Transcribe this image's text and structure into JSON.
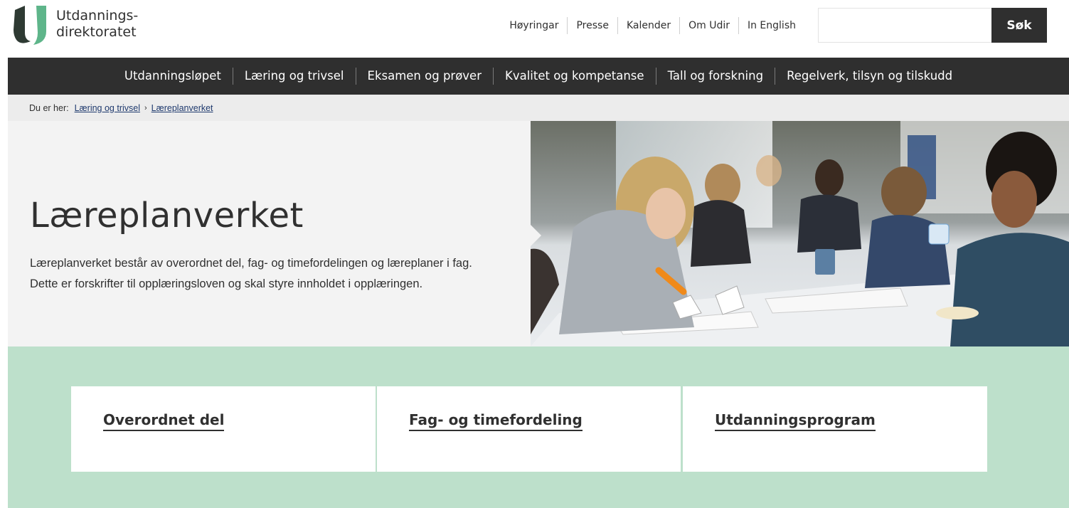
{
  "header": {
    "logo_line1": "Utdannings-",
    "logo_line2": "direktoratet",
    "utility_links": [
      "Høyringar",
      "Presse",
      "Kalender",
      "Om Udir",
      "In English"
    ],
    "search": {
      "placeholder": "",
      "value": "",
      "button_label": "Søk"
    }
  },
  "main_nav": [
    "Utdanningsløpet",
    "Læring og trivsel",
    "Eksamen og prøver",
    "Kvalitet og kompetanse",
    "Tall og forskning",
    "Regelverk, tilsyn og tilskudd"
  ],
  "breadcrumb": {
    "label": "Du er her:",
    "items": [
      "Læring og trivsel",
      "Læreplanverket"
    ],
    "separator": "›"
  },
  "hero": {
    "title": "Læreplanverket",
    "description": "Læreplanverket består av overordnet del, fag- og timefordelingen og læreplaner i fag. Dette er forskrifter til opplæringsloven og skal styre innholdet i opplæringen."
  },
  "cards": [
    "Overordnet del",
    "Fag- og timefordeling",
    "Utdanningsprogram"
  ],
  "colors": {
    "dark": "#2f2f2f",
    "green_bg": "#bde0cb",
    "logo_dark": "#2e3a33",
    "logo_green": "#5eb58a",
    "link_blue": "#1f3a6e"
  }
}
